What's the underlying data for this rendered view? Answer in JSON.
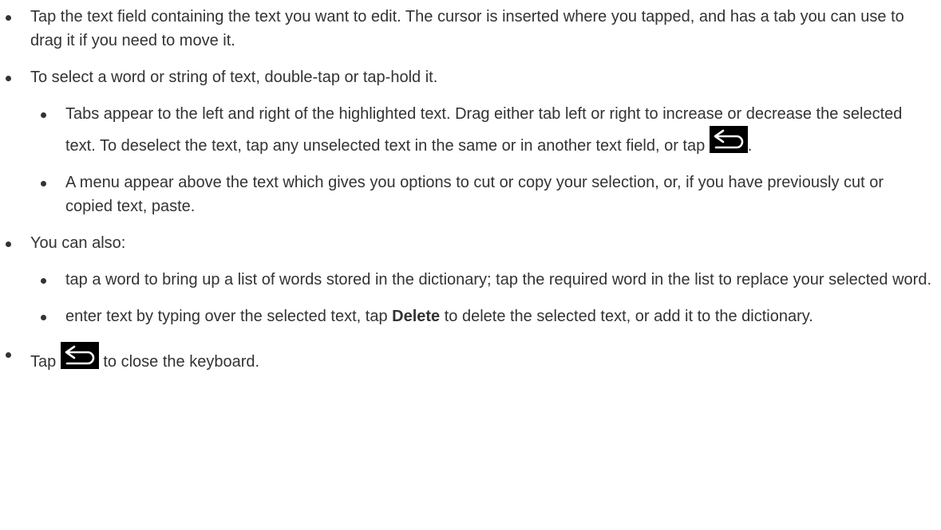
{
  "items": [
    {
      "text": "Tap the text field containing the text you want to edit. The cursor is inserted where you tapped, and has a tab you can use to drag it if you need to move it."
    },
    {
      "text": "To select a word or string of text, double-tap or tap-hold it.",
      "subitems": [
        {
          "text_before_icon": "Tabs appear to the left and right of the highlighted text. Drag either tab left or right to increase or decrease the selected text. To deselect the text, tap any unselected text in the same or in another text field, or tap",
          "icon": "back-arrow-icon",
          "text_after_icon": "."
        },
        {
          "text": "A menu appear above the text which gives you options to cut or copy your selection, or, if you have previously cut or copied text, paste."
        }
      ]
    },
    {
      "text": "You can also:",
      "subitems": [
        {
          "text": "tap a word to bring up a list of words stored in the dictionary; tap the required word in the list to replace your selected word."
        },
        {
          "text_before_bold": "enter text by typing over the selected text, tap ",
          "bold": "Delete",
          "text_after_bold": " to delete the selected text, or add it to the dictionary."
        }
      ]
    },
    {
      "text_before_icon": "Tap",
      "icon": "back-arrow-icon",
      "text_after_icon": "to close the keyboard."
    }
  ],
  "colors": {
    "text": "#333333",
    "icon_background": "#000000",
    "icon_stroke": "#ffffff"
  }
}
